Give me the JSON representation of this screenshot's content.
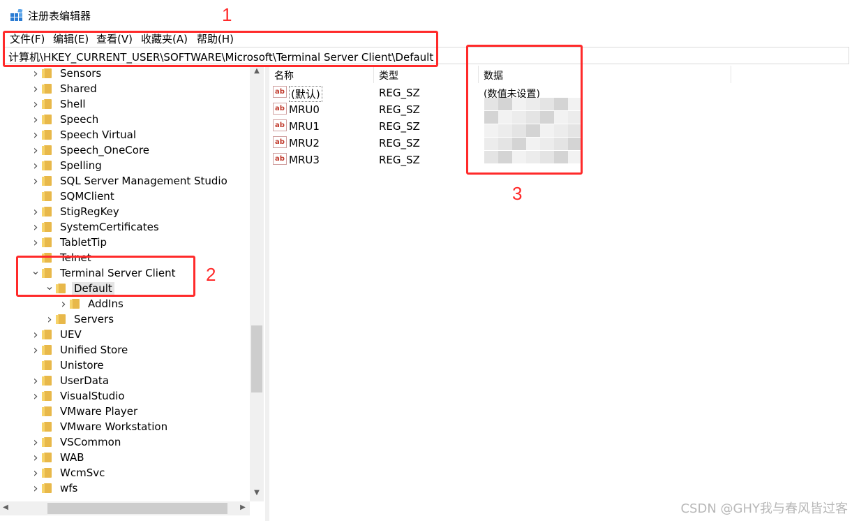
{
  "window": {
    "title": "注册表编辑器",
    "icon": "registry-editor-icon"
  },
  "menu": {
    "items": [
      "文件(F)",
      "编辑(E)",
      "查看(V)",
      "收藏夹(A)",
      "帮助(H)"
    ]
  },
  "address": {
    "path": "计算机\\HKEY_CURRENT_USER\\SOFTWARE\\Microsoft\\Terminal Server Client\\Default"
  },
  "tree": {
    "items": [
      {
        "label": "Sensors",
        "level": 0,
        "expander": "collapsed"
      },
      {
        "label": "Shared",
        "level": 0,
        "expander": "collapsed"
      },
      {
        "label": "Shell",
        "level": 0,
        "expander": "collapsed"
      },
      {
        "label": "Speech",
        "level": 0,
        "expander": "collapsed"
      },
      {
        "label": "Speech Virtual",
        "level": 0,
        "expander": "collapsed"
      },
      {
        "label": "Speech_OneCore",
        "level": 0,
        "expander": "collapsed"
      },
      {
        "label": "Spelling",
        "level": 0,
        "expander": "collapsed"
      },
      {
        "label": "SQL Server Management Studio",
        "level": 0,
        "expander": "collapsed"
      },
      {
        "label": "SQMClient",
        "level": 0,
        "expander": "none"
      },
      {
        "label": "StigRegKey",
        "level": 0,
        "expander": "collapsed"
      },
      {
        "label": "SystemCertificates",
        "level": 0,
        "expander": "collapsed"
      },
      {
        "label": "TabletTip",
        "level": 0,
        "expander": "collapsed"
      },
      {
        "label": "Telnet",
        "level": 0,
        "expander": "none"
      },
      {
        "label": "Terminal Server Client",
        "level": 0,
        "expander": "expanded"
      },
      {
        "label": "Default",
        "level": 1,
        "expander": "expanded",
        "selected": true
      },
      {
        "label": "AddIns",
        "level": 2,
        "expander": "collapsed"
      },
      {
        "label": "Servers",
        "level": 1,
        "expander": "collapsed"
      },
      {
        "label": "UEV",
        "level": 0,
        "expander": "collapsed"
      },
      {
        "label": "Unified Store",
        "level": 0,
        "expander": "collapsed"
      },
      {
        "label": "Unistore",
        "level": 0,
        "expander": "none"
      },
      {
        "label": "UserData",
        "level": 0,
        "expander": "collapsed"
      },
      {
        "label": "VisualStudio",
        "level": 0,
        "expander": "collapsed"
      },
      {
        "label": "VMware Player",
        "level": 0,
        "expander": "none"
      },
      {
        "label": "VMware Workstation",
        "level": 0,
        "expander": "none"
      },
      {
        "label": "VSCommon",
        "level": 0,
        "expander": "collapsed"
      },
      {
        "label": "WAB",
        "level": 0,
        "expander": "collapsed"
      },
      {
        "label": "WcmSvc",
        "level": 0,
        "expander": "collapsed"
      },
      {
        "label": "wfs",
        "level": 0,
        "expander": "collapsed"
      }
    ]
  },
  "values": {
    "headers": {
      "name": "名称",
      "type": "类型",
      "data": "数据"
    },
    "rows": [
      {
        "name": "(默认)",
        "type": "REG_SZ",
        "data": "(数值未设置)"
      },
      {
        "name": "MRU0",
        "type": "REG_SZ",
        "data": ""
      },
      {
        "name": "MRU1",
        "type": "REG_SZ",
        "data": ""
      },
      {
        "name": "MRU2",
        "type": "REG_SZ",
        "data": ""
      },
      {
        "name": "MRU3",
        "type": "REG_SZ",
        "data": ""
      }
    ]
  },
  "annotations": {
    "one": "1",
    "two": "2",
    "three": "3",
    "color": "#ff2a2a"
  },
  "watermark": "CSDN @GHY我与春风皆过客"
}
